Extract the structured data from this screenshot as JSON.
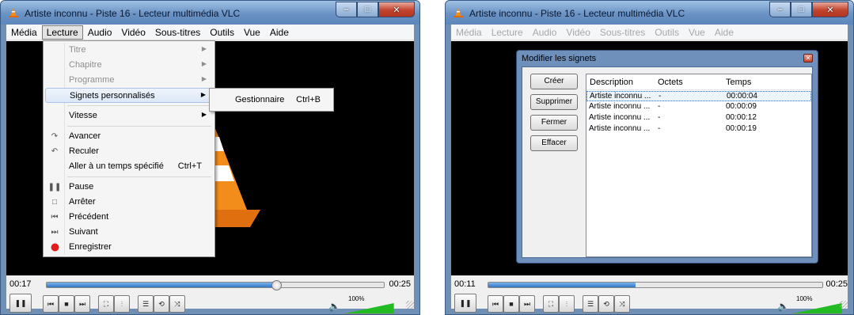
{
  "window1": {
    "title": "Artiste inconnu - Piste 16 - Lecteur multimédia VLC",
    "menubar": [
      "Média",
      "Lecture",
      "Audio",
      "Vidéo",
      "Sous-titres",
      "Outils",
      "Vue",
      "Aide"
    ],
    "active_menu": "Lecture",
    "lecture_menu": {
      "titre": "Titre",
      "chapitre": "Chapitre",
      "programme": "Programme",
      "signets": "Signets personnalisés",
      "vitesse": "Vitesse",
      "avancer": "Avancer",
      "reculer": "Reculer",
      "aller": "Aller à un temps spécifié",
      "aller_shortcut": "Ctrl+T",
      "pause": "Pause",
      "arreter": "Arrêter",
      "precedent": "Précédent",
      "suivant": "Suivant",
      "enregistrer": "Enregistrer"
    },
    "submenu": {
      "gestionnaire": "Gestionnaire",
      "gestionnaire_shortcut": "Ctrl+B"
    },
    "elapsed": "00:17",
    "duration": "00:25",
    "seek_fraction": 0.68,
    "volume_label": "100%",
    "volume_fraction": 1.0
  },
  "window2": {
    "title": "Artiste inconnu - Piste 16 - Lecteur multimédia VLC",
    "menubar": [
      "Média",
      "Lecture",
      "Audio",
      "Vidéo",
      "Sous-titres",
      "Outils",
      "Vue",
      "Aide"
    ],
    "dialog": {
      "title": "Modifier les signets",
      "buttons": {
        "creer": "Créer",
        "supprimer": "Supprimer",
        "fermer": "Fermer",
        "effacer": "Effacer"
      },
      "columns": {
        "description": "Description",
        "octets": "Octets",
        "temps": "Temps"
      },
      "rows": [
        {
          "description": "Artiste inconnu ...",
          "octets": "-",
          "temps": "00:00:04"
        },
        {
          "description": "Artiste inconnu ...",
          "octets": "-",
          "temps": "00:00:09"
        },
        {
          "description": "Artiste inconnu ...",
          "octets": "-",
          "temps": "00:00:12"
        },
        {
          "description": "Artiste inconnu ...",
          "octets": "-",
          "temps": "00:00:19"
        }
      ]
    },
    "elapsed": "00:11",
    "duration": "00:25",
    "seek_fraction": 0.44,
    "volume_label": "100%",
    "volume_fraction": 1.0
  },
  "colors": {
    "titlebar": "#6a92c4",
    "seek_fill": "#2f76c6",
    "volume_fill": "#22bb22",
    "cone_orange": "#f28c1a"
  }
}
